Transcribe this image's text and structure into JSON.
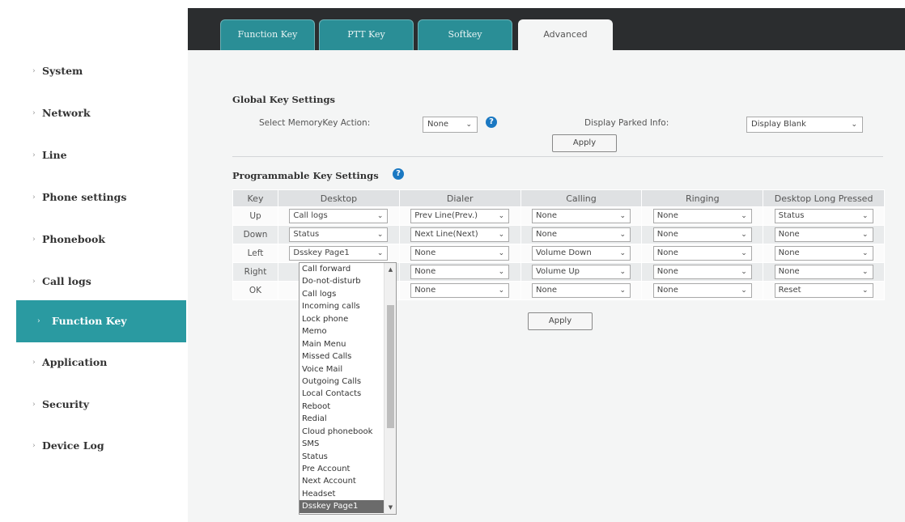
{
  "tabs": [
    {
      "label": "Function Key",
      "active": false
    },
    {
      "label": "PTT Key",
      "active": false
    },
    {
      "label": "Softkey",
      "active": false
    },
    {
      "label": "Advanced",
      "active": true
    }
  ],
  "sidebar": {
    "items": [
      {
        "label": "System",
        "active": false
      },
      {
        "label": "Network",
        "active": false
      },
      {
        "label": "Line",
        "active": false
      },
      {
        "label": "Phone settings",
        "active": false
      },
      {
        "label": "Phonebook",
        "active": false
      },
      {
        "label": "Call logs",
        "active": false
      },
      {
        "label": "Function Key",
        "active": true
      },
      {
        "label": "Application",
        "active": false
      },
      {
        "label": "Security",
        "active": false
      },
      {
        "label": "Device Log",
        "active": false
      }
    ]
  },
  "global": {
    "title": "Global Key Settings",
    "memorykey_label": "Select MemoryKey Action:",
    "memorykey_value": "None",
    "parked_label": "Display Parked Info:",
    "parked_value": "Display Blank",
    "apply_label": "Apply"
  },
  "programmable": {
    "title": "Programmable Key Settings",
    "apply_label": "Apply",
    "headers": [
      "Key",
      "Desktop",
      "Dialer",
      "Calling",
      "Ringing",
      "Desktop Long Pressed"
    ],
    "rows": [
      {
        "key": "Up",
        "values": [
          "Call logs",
          "Prev Line(Prev.)",
          "None",
          "None",
          "Status"
        ]
      },
      {
        "key": "Down",
        "values": [
          "Status",
          "Next Line(Next)",
          "None",
          "None",
          "None"
        ]
      },
      {
        "key": "Left",
        "values": [
          "Dsskey Page1",
          "None",
          "Volume Down",
          "None",
          "None"
        ]
      },
      {
        "key": "Right",
        "values": [
          "",
          "None",
          "Volume Up",
          "None",
          "None"
        ]
      },
      {
        "key": "OK",
        "values": [
          "",
          "None",
          "None",
          "None",
          "Reset"
        ]
      }
    ]
  },
  "dropdown": {
    "options": [
      "Call forward",
      "Do-not-disturb",
      "Call logs",
      "Incoming calls",
      "Lock phone",
      "Memo",
      "Main Menu",
      "Missed Calls",
      "Voice Mail",
      "Outgoing Calls",
      "Local Contacts",
      "Reboot",
      "Redial",
      "Cloud phonebook",
      "SMS",
      "Status",
      "Pre Account",
      "Next Account",
      "Headset",
      "Dsskey Page1"
    ],
    "selected": "Dsskey Page1"
  },
  "colors": {
    "accent": "#2a9aa1",
    "topbar": "#2b2d2f",
    "help": "#1a78c2"
  }
}
